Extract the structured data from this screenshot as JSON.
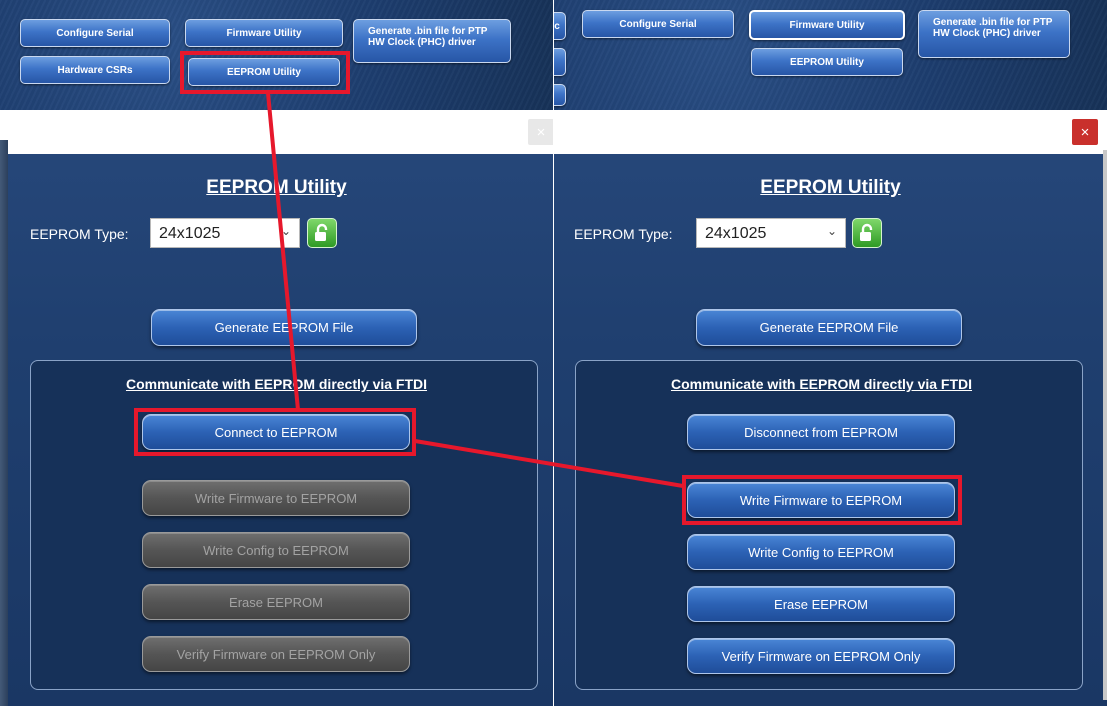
{
  "top_buttons": {
    "configure_serial": "Configure Serial",
    "firmware_utility": "Firmware Utility",
    "generate_bin_line1": "Generate .bin file for PTP",
    "generate_bin_line2": "HW Clock (PHC) driver",
    "hardware_csrs": "Hardware CSRs",
    "eeprom_utility": "EEPROM Utility",
    "clipped_label": "c"
  },
  "dialog": {
    "title": "EEPROM Utility",
    "close_glyph": "×",
    "eeprom_type_label": "EEPROM Type:",
    "eeprom_type_value": "24x1025",
    "generate_file": "Generate EEPROM File",
    "group_title": "Communicate with EEPROM directly via FTDI"
  },
  "left_state": {
    "connect": "Connect to EEPROM",
    "write_firmware": "Write Firmware to EEPROM",
    "write_config": "Write Config to EEPROM",
    "erase": "Erase EEPROM",
    "verify": "Verify Firmware on EEPROM Only",
    "actions_enabled": false
  },
  "right_state": {
    "disconnect": "Disconnect from EEPROM",
    "write_firmware": "Write Firmware to EEPROM",
    "write_config": "Write Config to EEPROM",
    "erase": "Erase EEPROM",
    "verify": "Verify Firmware on EEPROM Only",
    "actions_enabled": true
  },
  "colors": {
    "annotation_red": "#e6182c",
    "button_blue": "#2c62b5",
    "disabled_gray": "#555555",
    "lock_green": "#2e9a24"
  },
  "icons": {
    "lock": "lock-open-icon",
    "chevron": "chevron-down-icon"
  }
}
